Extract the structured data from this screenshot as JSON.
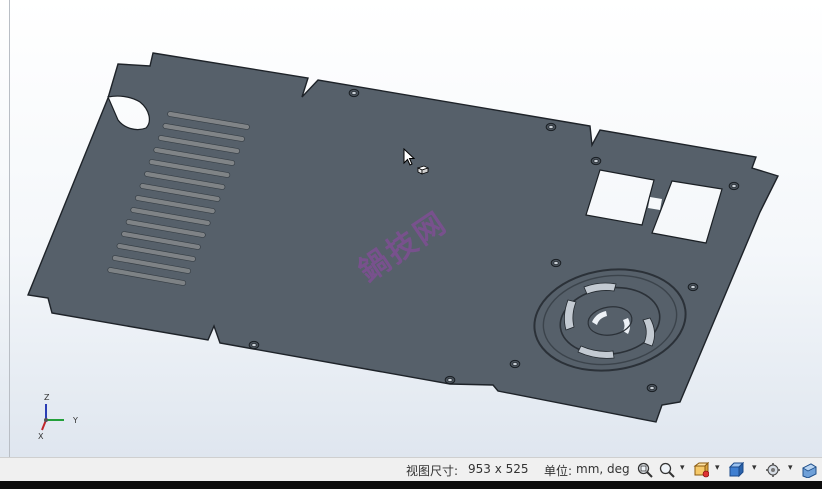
{
  "viewport": {
    "watermark": "鍋技网",
    "axes": {
      "z": "Z",
      "y": "Y",
      "x": "X"
    }
  },
  "status_bar": {
    "view_size_label": "视图尺寸:",
    "view_size_value": "953 x 525",
    "units_label": "单位:",
    "units_value": "mm, deg"
  },
  "toolbar_icons": [
    "zoom-fit-icon",
    "zoom-icon",
    "view-orient-icon",
    "display-style-icon",
    "view-settings-icon",
    "shaded-view-icon"
  ],
  "colors": {
    "part_fill": "#56606a",
    "part_edge": "#1e2329",
    "watermark": "#9646aa"
  }
}
